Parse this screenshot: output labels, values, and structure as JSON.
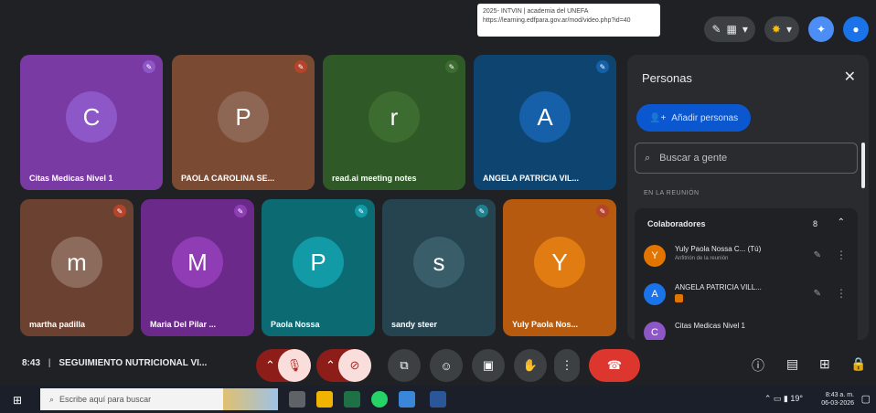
{
  "tooltip": {
    "line1": "2025- INTVIN | academia del UNEFA",
    "line2": "https://learning.edfpara.gov.ar/mod/video.php?id=40"
  },
  "top_bar": {
    "record_icon": "edit-icon",
    "layout_icon": "layout-icon",
    "apps_icon": "apps-icon",
    "gemini_icon": "gemini-icon",
    "profile_icon": "profile-icon"
  },
  "tiles": [
    {
      "name": "Citas Medicas Nivel 1",
      "initial": "C",
      "bg": "#7a3aa3",
      "avatar": "#8e57c7",
      "mic": "#8e57c7"
    },
    {
      "name": "PAOLA CAROLINA SE...",
      "initial": "P",
      "bg": "#7b4a33",
      "avatar": "#8d6654",
      "mic": "#b5442b"
    },
    {
      "name": "read.ai meeting notes",
      "initial": "r",
      "bg": "#2f5a28",
      "avatar": "#3c6c30",
      "mic": "#3c6c30"
    },
    {
      "name": "ANGELA PATRICIA VIL...",
      "initial": "A",
      "bg": "#0e4470",
      "avatar": "#1560a8",
      "mic": "#1560a8"
    },
    {
      "name": "martha padilla",
      "initial": "m",
      "bg": "#6b4232",
      "avatar": "#8c6a5c",
      "mic": "#b5442b"
    },
    {
      "name": "Maria Del Pilar ...",
      "initial": "M",
      "bg": "#6b2a8a",
      "avatar": "#8f3cb5",
      "mic": "#8f3cb5"
    },
    {
      "name": "Paola Nossa",
      "initial": "P",
      "bg": "#0c6a72",
      "avatar": "#129aa6",
      "mic": "#129aa6"
    },
    {
      "name": "sandy steer",
      "initial": "s",
      "bg": "#25444f",
      "avatar": "#3a5d6a",
      "mic": "#1f7f8f"
    },
    {
      "name": "Yuly Paola Nos...",
      "initial": "Y",
      "bg": "#b55a0e",
      "avatar": "#e17c12",
      "mic": "#b5442b"
    }
  ],
  "panel": {
    "title": "Personas",
    "close_icon": "close-icon",
    "add_label": "Añadir personas",
    "search_placeholder": "Buscar a gente",
    "section_label": "EN LA REUNIÓN",
    "group_label": "Colaboradores",
    "group_count": "8",
    "people": [
      {
        "name": "Yuly Paola Nossa C... (Tú)",
        "sub": "Anfitrión de la reunión",
        "initial": "Y",
        "color": "#e37400"
      },
      {
        "name": "ANGELA PATRICIA VILL...",
        "sub": "",
        "initial": "A",
        "color": "#1a73e8"
      },
      {
        "name": "Citas Medicas Nivel 1",
        "sub": "",
        "initial": "C",
        "color": "#8e57c7"
      }
    ]
  },
  "meeting": {
    "time": "8:43",
    "separator": "|",
    "title": "SEGUIMIENTO NUTRICIONAL VI..."
  },
  "controls": {
    "mic_icon": "mic-off-icon",
    "cam_icon": "camera-off-icon",
    "captions_icon": "captions-icon",
    "emoji_icon": "emoji-icon",
    "present_icon": "present-icon",
    "hand_icon": "raise-hand-icon",
    "more_icon": "more-vert-icon",
    "hangup_icon": "hangup-icon",
    "info_icon": "info-icon",
    "chat_icon": "chat-icon",
    "activities_icon": "activities-icon",
    "lock_icon": "lock-icon"
  },
  "taskbar": {
    "search_placeholder": "Escribe aquí para buscar",
    "weather": "19°",
    "clock_time": "8:43 a. m.",
    "clock_date": "06-03-2026"
  }
}
